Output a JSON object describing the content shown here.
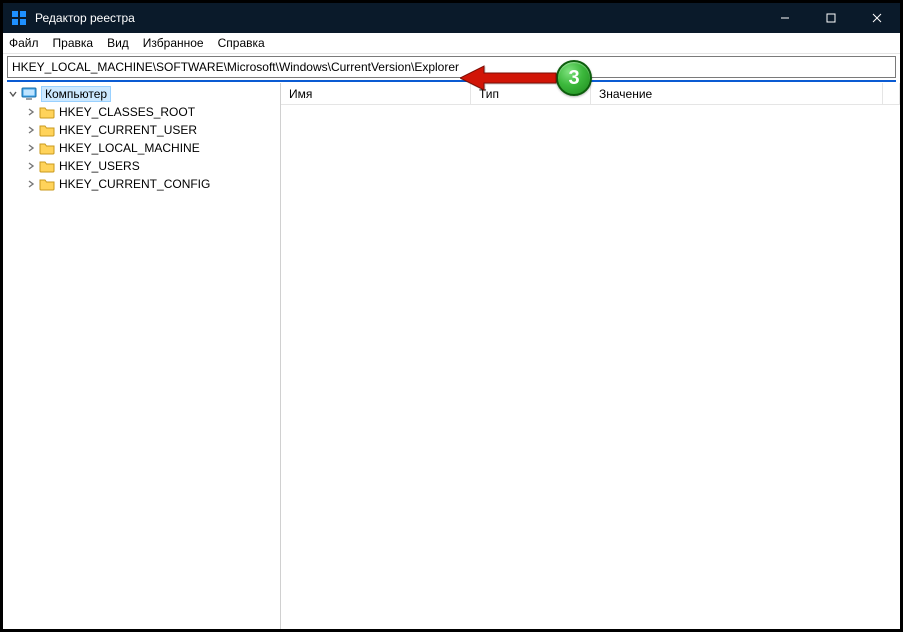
{
  "titlebar": {
    "title": "Редактор реестра"
  },
  "menubar": {
    "file": "Файл",
    "edit": "Правка",
    "view": "Вид",
    "favorites": "Избранное",
    "help": "Справка"
  },
  "address": {
    "path": "HKEY_LOCAL_MACHINE\\SOFTWARE\\Microsoft\\Windows\\CurrentVersion\\Explorer"
  },
  "tree": {
    "root": "Компьютер",
    "children": [
      "HKEY_CLASSES_ROOT",
      "HKEY_CURRENT_USER",
      "HKEY_LOCAL_MACHINE",
      "HKEY_USERS",
      "HKEY_CURRENT_CONFIG"
    ]
  },
  "columns": {
    "name": "Имя",
    "type": "Тип",
    "value": "Значение"
  },
  "annotation": {
    "step": "3"
  }
}
